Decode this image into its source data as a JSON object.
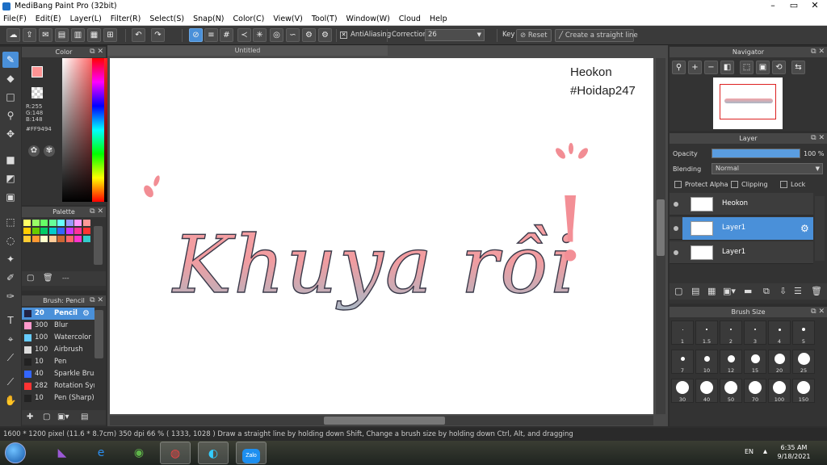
{
  "window": {
    "title": "MediBang Paint Pro (32bit)"
  },
  "menu": [
    "File(F)",
    "Edit(E)",
    "Layer(L)",
    "Filter(R)",
    "Select(S)",
    "Snap(N)",
    "Color(C)",
    "View(V)",
    "Tool(T)",
    "Window(W)",
    "Cloud",
    "Help"
  ],
  "toolbar": {
    "antialiasing": "AntiAliasing",
    "correction_label": "Correction",
    "correction_value": "26",
    "key_label": "Key",
    "reset_label": "Reset",
    "straight_line_label": "Create a straight line"
  },
  "color": {
    "title": "Color",
    "r": "R:255",
    "g": "G:148",
    "b": "B:148",
    "hex": "#FF9494",
    "current": "#ff9494"
  },
  "palette": {
    "title": "Palette",
    "footer": "---",
    "swatches": [
      "#ffff66",
      "#99ff66",
      "#66ff66",
      "#66ff99",
      "#66ffff",
      "#9999ff",
      "#ff99ff",
      "#ff9999",
      "#ffcc00",
      "#66cc00",
      "#00cc66",
      "#00cccc",
      "#3366ff",
      "#cc33ff",
      "#ff3399",
      "#ff3333",
      "#ffcc33",
      "#ff9933",
      "#ffffcc",
      "#ffcc99",
      "#cc6633",
      "#ff6666",
      "#ff33cc",
      "#33cccc"
    ]
  },
  "brush": {
    "title": "Brush: Pencil",
    "items": [
      {
        "size": "20",
        "name": "Pencil",
        "color": "#222244",
        "selected": true
      },
      {
        "size": "300",
        "name": "Blur",
        "color": "#ff99cc",
        "selected": false
      },
      {
        "size": "100",
        "name": "Watercolor",
        "color": "#66ccff",
        "selected": false
      },
      {
        "size": "100",
        "name": "Airbrush",
        "color": "#dddddd",
        "selected": false
      },
      {
        "size": "10",
        "name": "Pen",
        "color": "#222222",
        "selected": false
      },
      {
        "size": "40",
        "name": "Sparkle Brush",
        "color": "#3366ff",
        "selected": false
      },
      {
        "size": "282",
        "name": "Rotation Sym",
        "color": "#ff3333",
        "selected": false
      },
      {
        "size": "10",
        "name": "Pen (Sharp)",
        "color": "#222222",
        "selected": false
      }
    ]
  },
  "document": {
    "tab": "Untitled"
  },
  "canvas_text": {
    "author": "Heokon",
    "tag": "#Hoidap247",
    "main": "Khuya rồi",
    "excl": "!"
  },
  "navigator": {
    "title": "Navigator"
  },
  "layer": {
    "title": "Layer",
    "opacity_label": "Opacity",
    "opacity_value": "100 %",
    "opacity_fraction": 1.0,
    "blending_label": "Blending",
    "blending_value": "Normal",
    "protect_alpha": "Protect Alpha",
    "clipping": "Clipping",
    "lock": "Lock",
    "items": [
      {
        "name": "Heokon",
        "selected": false
      },
      {
        "name": "Layer1",
        "selected": true
      },
      {
        "name": "Layer1",
        "selected": false
      }
    ]
  },
  "brushsize": {
    "title": "Brush Size",
    "sizes": [
      "1",
      "1.5",
      "2",
      "3",
      "4",
      "5",
      "7",
      "10",
      "12",
      "15",
      "20",
      "25",
      "30",
      "40",
      "50",
      "70",
      "100",
      "150"
    ]
  },
  "status": {
    "size": "1600 * 1200 pixel",
    "physical": "(11.6 * 8.7cm)",
    "dpi": "350 dpi",
    "zoom": "66 %",
    "coords": "( 1333, 1028 )",
    "hint": "Draw a straight line by holding down Shift, Change a brush size by holding down Ctrl, Alt, and dragging"
  },
  "taskbar": {
    "lang": "EN",
    "time": "6:35 AM",
    "date": "9/18/2021",
    "zalo": "Zalo"
  }
}
